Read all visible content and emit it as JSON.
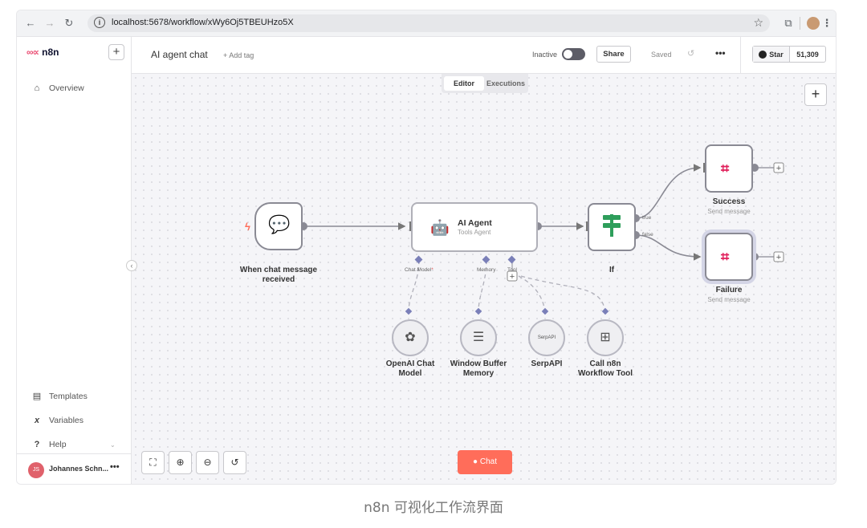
{
  "browser": {
    "url": "localhost:5678/workflow/xWy6Oj5TBEUHzo5X"
  },
  "sidebar": {
    "logo_text": "n8n",
    "items": [
      {
        "label": "Overview",
        "icon": "home-icon"
      },
      {
        "label": "Templates",
        "icon": "templates-icon"
      },
      {
        "label": "Variables",
        "icon": "variables-icon"
      },
      {
        "label": "Help",
        "icon": "help-icon"
      }
    ],
    "user": {
      "initials": "JS",
      "name": "Johannes Schn..."
    }
  },
  "header": {
    "workflow_name": "AI agent chat",
    "add_tag": "+ Add tag",
    "status": "Inactive",
    "share": "Share",
    "saved": "Saved",
    "github": {
      "star": "Star",
      "count": "51,309"
    }
  },
  "canvas": {
    "tabs": [
      {
        "label": "Editor",
        "active": true
      },
      {
        "label": "Executions",
        "active": false
      }
    ],
    "chat_button": "Chat",
    "nodes": {
      "trigger": {
        "title_line1": "When chat message",
        "title_line2": "received"
      },
      "agent": {
        "title": "AI Agent",
        "subtitle": "Tools Agent",
        "ports": [
          "Chat Model",
          "Memory",
          "Tool"
        ],
        "required_mark": "*"
      },
      "if": {
        "title": "If",
        "outputs": [
          "true",
          "false"
        ]
      },
      "success": {
        "title": "Success",
        "subtitle": "Send message"
      },
      "failure": {
        "title": "Failure",
        "subtitle": "Send message"
      },
      "openai": {
        "line1": "OpenAI Chat",
        "line2": "Model"
      },
      "memory": {
        "line1": "Window Buffer",
        "line2": "Memory"
      },
      "serpapi": {
        "title": "SerpAPI",
        "icon_text": "SerpAPI"
      },
      "workflow_tool": {
        "line1": "Call n8n",
        "line2": "Workflow Tool"
      }
    }
  },
  "caption": "n8n 可视化工作流界面",
  "colors": {
    "accent": "#ff6d5a",
    "brand": "#ea4b71",
    "trigger": "#ff6d5a",
    "if_green": "#2e9e5b"
  }
}
